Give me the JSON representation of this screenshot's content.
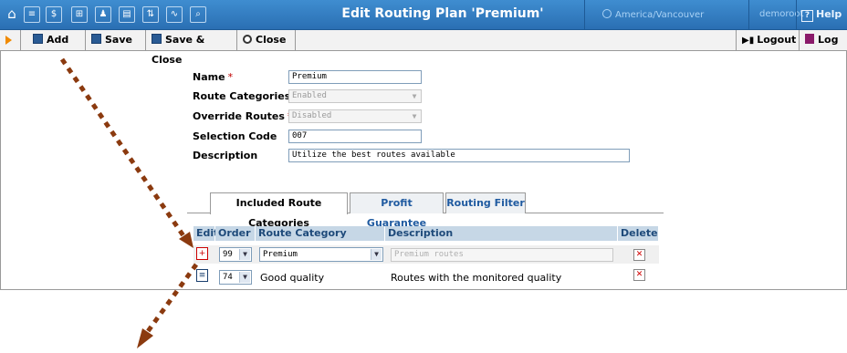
{
  "titlebar": {
    "title": "Edit Routing Plan 'Premium'",
    "timezone": "America/Vancouver",
    "user": "demoroot",
    "help": "Help",
    "icons": [
      "home-icon",
      "list-icon",
      "dollar-icon",
      "grid-icon",
      "person-icon",
      "document-icon",
      "connection-icon",
      "chart-icon",
      "search-icon"
    ]
  },
  "toolbar": {
    "add": "Add",
    "save": "Save",
    "save_close": "Save & Close",
    "close": "Close",
    "logout": "Logout",
    "log": "Log"
  },
  "form": {
    "name_label": "Name",
    "name_value": "Premium",
    "route_categories_label": "Route Categories",
    "route_categories_value": "Enabled",
    "override_routes_label": "Override Routes",
    "override_routes_value": "Disabled",
    "selection_code_label": "Selection Code",
    "selection_code_value": "007",
    "description_label": "Description",
    "description_value": "Utilize the best routes available",
    "required_mark": "*"
  },
  "tabs": [
    {
      "label": "Included Route Categories",
      "active": true
    },
    {
      "label": "Profit Guarantee",
      "active": false
    },
    {
      "label": "Routing Filter",
      "active": false
    }
  ],
  "grid": {
    "headers": {
      "edit": "Edit",
      "order": "Order",
      "category": "Route Category",
      "description": "Description",
      "delete": "Delete"
    },
    "rows": [
      {
        "order": "99",
        "category": "Premium",
        "description": "Premium routes",
        "editing": true
      },
      {
        "order": "74",
        "category": "Good quality",
        "description": "Routes with the monitored quality",
        "editing": false
      }
    ]
  },
  "colors": {
    "titlebar": "#2a6fb3",
    "accent_orange": "#f08a00",
    "grid_header": "#c6d7e6",
    "arrow": "#8b3a0f",
    "delete_x": "#d00000"
  }
}
